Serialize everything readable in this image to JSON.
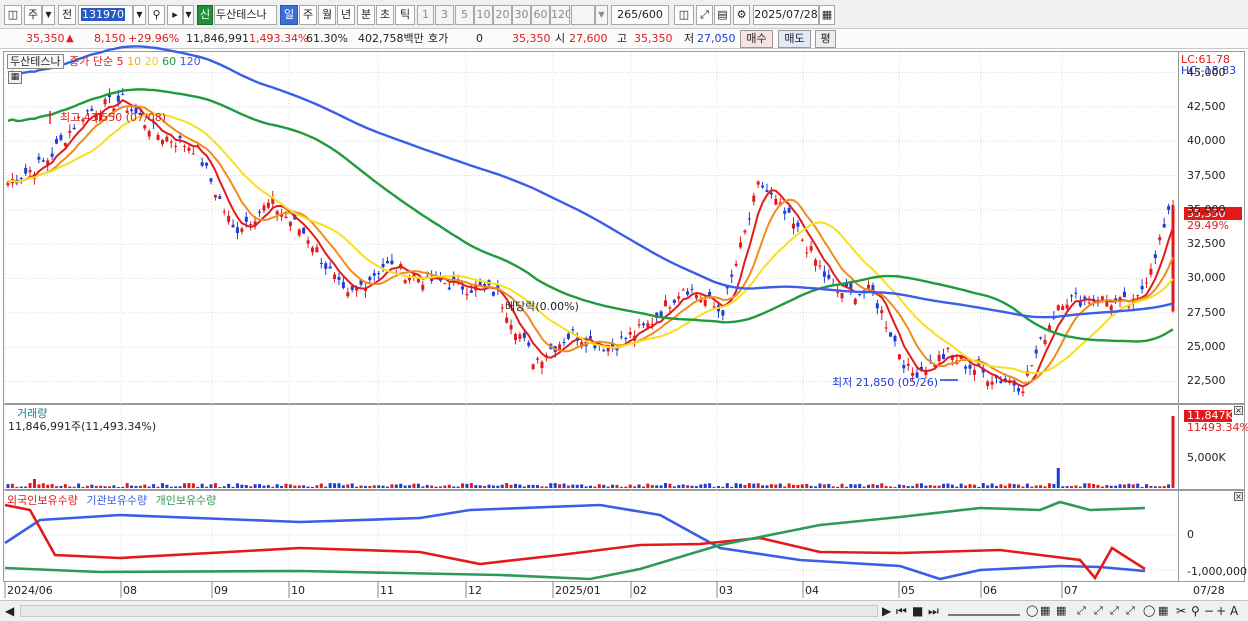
{
  "toolbar": {
    "period_main": "주",
    "prev_label": "전",
    "code": "131970",
    "sin_badge": "신",
    "stock_name": "두산테스나",
    "periods": [
      "일",
      "주",
      "월",
      "년",
      "분",
      "초",
      "틱"
    ],
    "nums": [
      "1",
      "3",
      "5",
      "10",
      "20",
      "30",
      "60",
      "120"
    ],
    "count": "265",
    "count_total": "/600",
    "date": "2025/07/28"
  },
  "info": {
    "price": "35,350",
    "change": "8,150",
    "change_pct": "+29.96%",
    "volume": "11,846,991",
    "vol_ratio": "1,493.34%",
    "turnover": "61.30%",
    "amount": "402,758백만",
    "hoga_label": "호가",
    "hoga_value": "0",
    "hoga_price": "35,350",
    "open_label": "시",
    "open": "27,600",
    "high_label": "고",
    "high": "35,350",
    "low_label": "저",
    "low": "27,050",
    "buy": "매수",
    "sell": "매도",
    "flat": "평"
  },
  "price_panel": {
    "legend_stock": "두산테스나",
    "legend_ma": "종가 단순",
    "ma_periods": [
      "5",
      "10",
      "20",
      "60",
      "120"
    ],
    "lc": "LC:61.78",
    "hc": "HC:-18.83",
    "high_note": "최고 43,550 (07/08)",
    "low_note": "최저 21,850 (05/26)",
    "dividend_note": "배당락(0.00%)",
    "last_price_tag": "35,350",
    "last_pct": "29.49%",
    "ticks": [
      "45,000",
      "42,500",
      "40,000",
      "37,500",
      "35,000",
      "32,500",
      "30,000",
      "27,500",
      "25,000",
      "22,500"
    ]
  },
  "volume_panel": {
    "title": "거래량",
    "value_text": "11,846,991주(11,493.34%)",
    "tag": "11,847K",
    "tag_pct": "11493.34%",
    "tick": "5,000K"
  },
  "holdings_panel": {
    "legends": [
      "외국인보유수량",
      "기관보유수량",
      "개인보유수량"
    ],
    "ticks": [
      "0",
      "-1,000,000"
    ]
  },
  "xaxis": {
    "labels": [
      "2024/06",
      "08",
      "09",
      "10",
      "11",
      "12",
      "2025/01",
      "02",
      "03",
      "04",
      "05",
      "06",
      "07"
    ],
    "last_date": "07/28"
  },
  "colors": {
    "up": "#e41a1a",
    "down": "#1c3dd8",
    "ma5": "#e41a1a",
    "ma10": "#f08c1e",
    "ma20": "#f5e020",
    "ma60": "#1f9a3c",
    "ma120": "#3a5ee8",
    "foreign": "#e41a1a",
    "institution": "#3a5ee8",
    "individual": "#2e9a5a"
  },
  "chart_data": [
    {
      "type": "line",
      "title": "두산테스나",
      "ylim": [
        21000,
        46500
      ],
      "x": [
        "2024/06",
        "2024/06",
        "2024/07",
        "2024/07",
        "2024/07",
        "2024/08",
        "2024/08",
        "2024/08",
        "2024/09",
        "2024/09",
        "2024/10",
        "2024/10",
        "2024/11",
        "2024/11",
        "2024/12",
        "2024/12",
        "2025/01",
        "2025/01",
        "2025/02",
        "2025/02",
        "2025/02",
        "2025/03",
        "2025/03",
        "2025/04",
        "2025/04",
        "2025/05",
        "2025/05",
        "2025/06",
        "2025/06",
        "2025/07",
        "2025/07",
        "2025/07/28"
      ],
      "series": [
        {
          "name": "종가",
          "values": [
            37000,
            38500,
            42000,
            43000,
            40500,
            39500,
            33500,
            35500,
            33000,
            28500,
            31000,
            30000,
            29500,
            29000,
            24000,
            26000,
            25000,
            26500,
            29500,
            27500,
            37000,
            33500,
            29000,
            29000,
            23000,
            24500,
            23000,
            22200,
            28500,
            28500,
            28000,
            35350
          ]
        }
      ],
      "ma_periods": [
        5,
        10,
        20,
        60,
        120
      ]
    },
    {
      "type": "bar",
      "title": "거래량",
      "series": [
        {
          "name": "거래량",
          "last_value": 11846991
        }
      ]
    },
    {
      "type": "line",
      "series": [
        {
          "name": "외국인보유수량"
        },
        {
          "name": "기관보유수량"
        },
        {
          "name": "개인보유수량"
        }
      ]
    }
  ]
}
